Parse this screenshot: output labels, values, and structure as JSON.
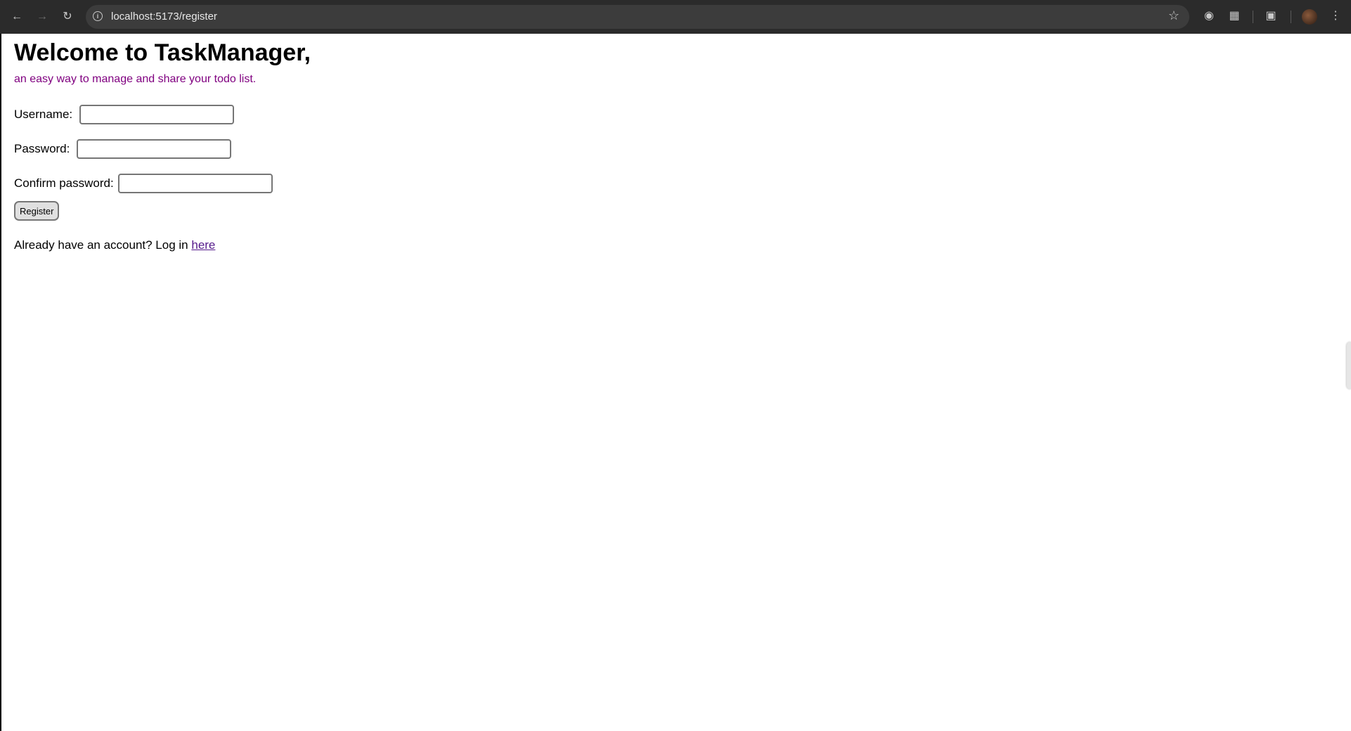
{
  "browser": {
    "url": "localhost:5173/register",
    "icons": {
      "back": "back-arrow-icon",
      "forward": "forward-arrow-icon",
      "reload": "reload-icon",
      "site_info": "info-icon",
      "bookmark": "star-icon",
      "extension_1": "grammarly-icon",
      "extensions": "puzzle-icon",
      "cast": "cast-search-icon",
      "menu": "kebab-menu-icon"
    }
  },
  "page": {
    "title": "Welcome to TaskManager,",
    "subtitle": "an easy way to manage and share your todo list.",
    "form": {
      "username_label": "Username:",
      "username_value": "",
      "password_label": "Password:",
      "password_value": "",
      "confirm_label": "Confirm password:",
      "confirm_value": "",
      "register_label": "Register"
    },
    "login_prompt": "Already have an account? Log in",
    "login_link": "here"
  },
  "colors": {
    "subtitle": "#800080",
    "link": "#551a8b",
    "browser_chrome": "#2b2b2b"
  }
}
